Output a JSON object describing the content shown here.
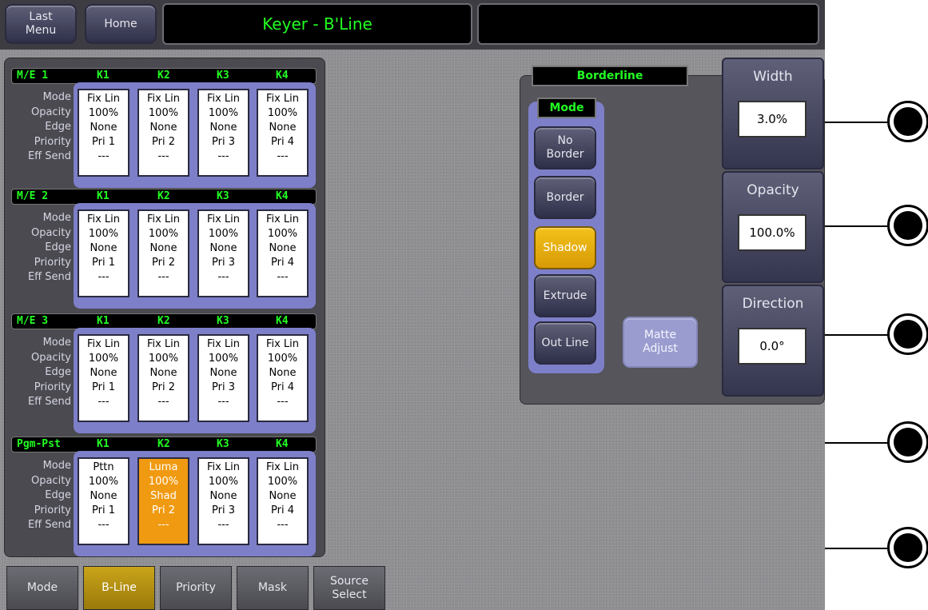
{
  "topbar": {
    "last_menu": "Last\nMenu",
    "home": "Home",
    "title": "Keyer - B'Line",
    "status": ""
  },
  "row_labels": [
    "Mode",
    "Opacity",
    "Edge",
    "Priority",
    "Eff Send"
  ],
  "me_rows": [
    {
      "name": "M/E 1",
      "keys": [
        "K1",
        "K2",
        "K3",
        "K4"
      ],
      "cards": [
        {
          "mode": "Fix Lin",
          "opacity": "100%",
          "edge": "None",
          "priority": "Pri 1",
          "eff_send": "---"
        },
        {
          "mode": "Fix Lin",
          "opacity": "100%",
          "edge": "None",
          "priority": "Pri 2",
          "eff_send": "---"
        },
        {
          "mode": "Fix Lin",
          "opacity": "100%",
          "edge": "None",
          "priority": "Pri 3",
          "eff_send": "---"
        },
        {
          "mode": "Fix Lin",
          "opacity": "100%",
          "edge": "None",
          "priority": "Pri 4",
          "eff_send": "---"
        }
      ]
    },
    {
      "name": "M/E 2",
      "keys": [
        "K1",
        "K2",
        "K3",
        "K4"
      ],
      "cards": [
        {
          "mode": "Fix Lin",
          "opacity": "100%",
          "edge": "None",
          "priority": "Pri 1",
          "eff_send": "---"
        },
        {
          "mode": "Fix Lin",
          "opacity": "100%",
          "edge": "None",
          "priority": "Pri 2",
          "eff_send": "---"
        },
        {
          "mode": "Fix Lin",
          "opacity": "100%",
          "edge": "None",
          "priority": "Pri 3",
          "eff_send": "---"
        },
        {
          "mode": "Fix Lin",
          "opacity": "100%",
          "edge": "None",
          "priority": "Pri 4",
          "eff_send": "---"
        }
      ]
    },
    {
      "name": "M/E 3",
      "keys": [
        "K1",
        "K2",
        "K3",
        "K4"
      ],
      "cards": [
        {
          "mode": "Fix Lin",
          "opacity": "100%",
          "edge": "None",
          "priority": "Pri 1",
          "eff_send": "---"
        },
        {
          "mode": "Fix Lin",
          "opacity": "100%",
          "edge": "None",
          "priority": "Pri 2",
          "eff_send": "---"
        },
        {
          "mode": "Fix Lin",
          "opacity": "100%",
          "edge": "None",
          "priority": "Pri 3",
          "eff_send": "---"
        },
        {
          "mode": "Fix Lin",
          "opacity": "100%",
          "edge": "None",
          "priority": "Pri 4",
          "eff_send": "---"
        }
      ]
    },
    {
      "name": "Pgm-Pst",
      "keys": [
        "K1",
        "K2",
        "K3",
        "K4"
      ],
      "cards": [
        {
          "mode": "Pttn",
          "opacity": "100%",
          "edge": "None",
          "priority": "Pri 1",
          "eff_send": "---"
        },
        {
          "mode": "Luma",
          "opacity": "100%",
          "edge": "Shad",
          "priority": "Pri 2",
          "eff_send": "---",
          "active": true
        },
        {
          "mode": "Fix Lin",
          "opacity": "100%",
          "edge": "None",
          "priority": "Pri 3",
          "eff_send": "---"
        },
        {
          "mode": "Fix Lin",
          "opacity": "100%",
          "edge": "None",
          "priority": "Pri 4",
          "eff_send": "---"
        }
      ]
    }
  ],
  "borderline": {
    "title": "Borderline",
    "mode_label": "Mode",
    "modes": [
      {
        "label": "No\nBorder",
        "selected": false
      },
      {
        "label": "Border",
        "selected": false
      },
      {
        "label": "Shadow",
        "selected": true
      },
      {
        "label": "Extrude",
        "selected": false
      },
      {
        "label": "Out Line",
        "selected": false
      }
    ],
    "matte_adjust": "Matte\nAdjust"
  },
  "params": [
    {
      "label": "Width",
      "value": "3.0%"
    },
    {
      "label": "Opacity",
      "value": "100.0%"
    },
    {
      "label": "Direction",
      "value": "0.0°"
    }
  ],
  "tabs": [
    {
      "label": "Mode",
      "selected": false
    },
    {
      "label": "B-Line",
      "selected": true
    },
    {
      "label": "Priority",
      "selected": false
    },
    {
      "label": "Mask",
      "selected": false
    },
    {
      "label": "Source\nSelect",
      "selected": false
    }
  ],
  "colors": {
    "accent_green": "#22ff22",
    "selected_orange": "#f09a12",
    "panel_blue": "#7d7fc9",
    "selected_yellow": "#f2c21a"
  }
}
